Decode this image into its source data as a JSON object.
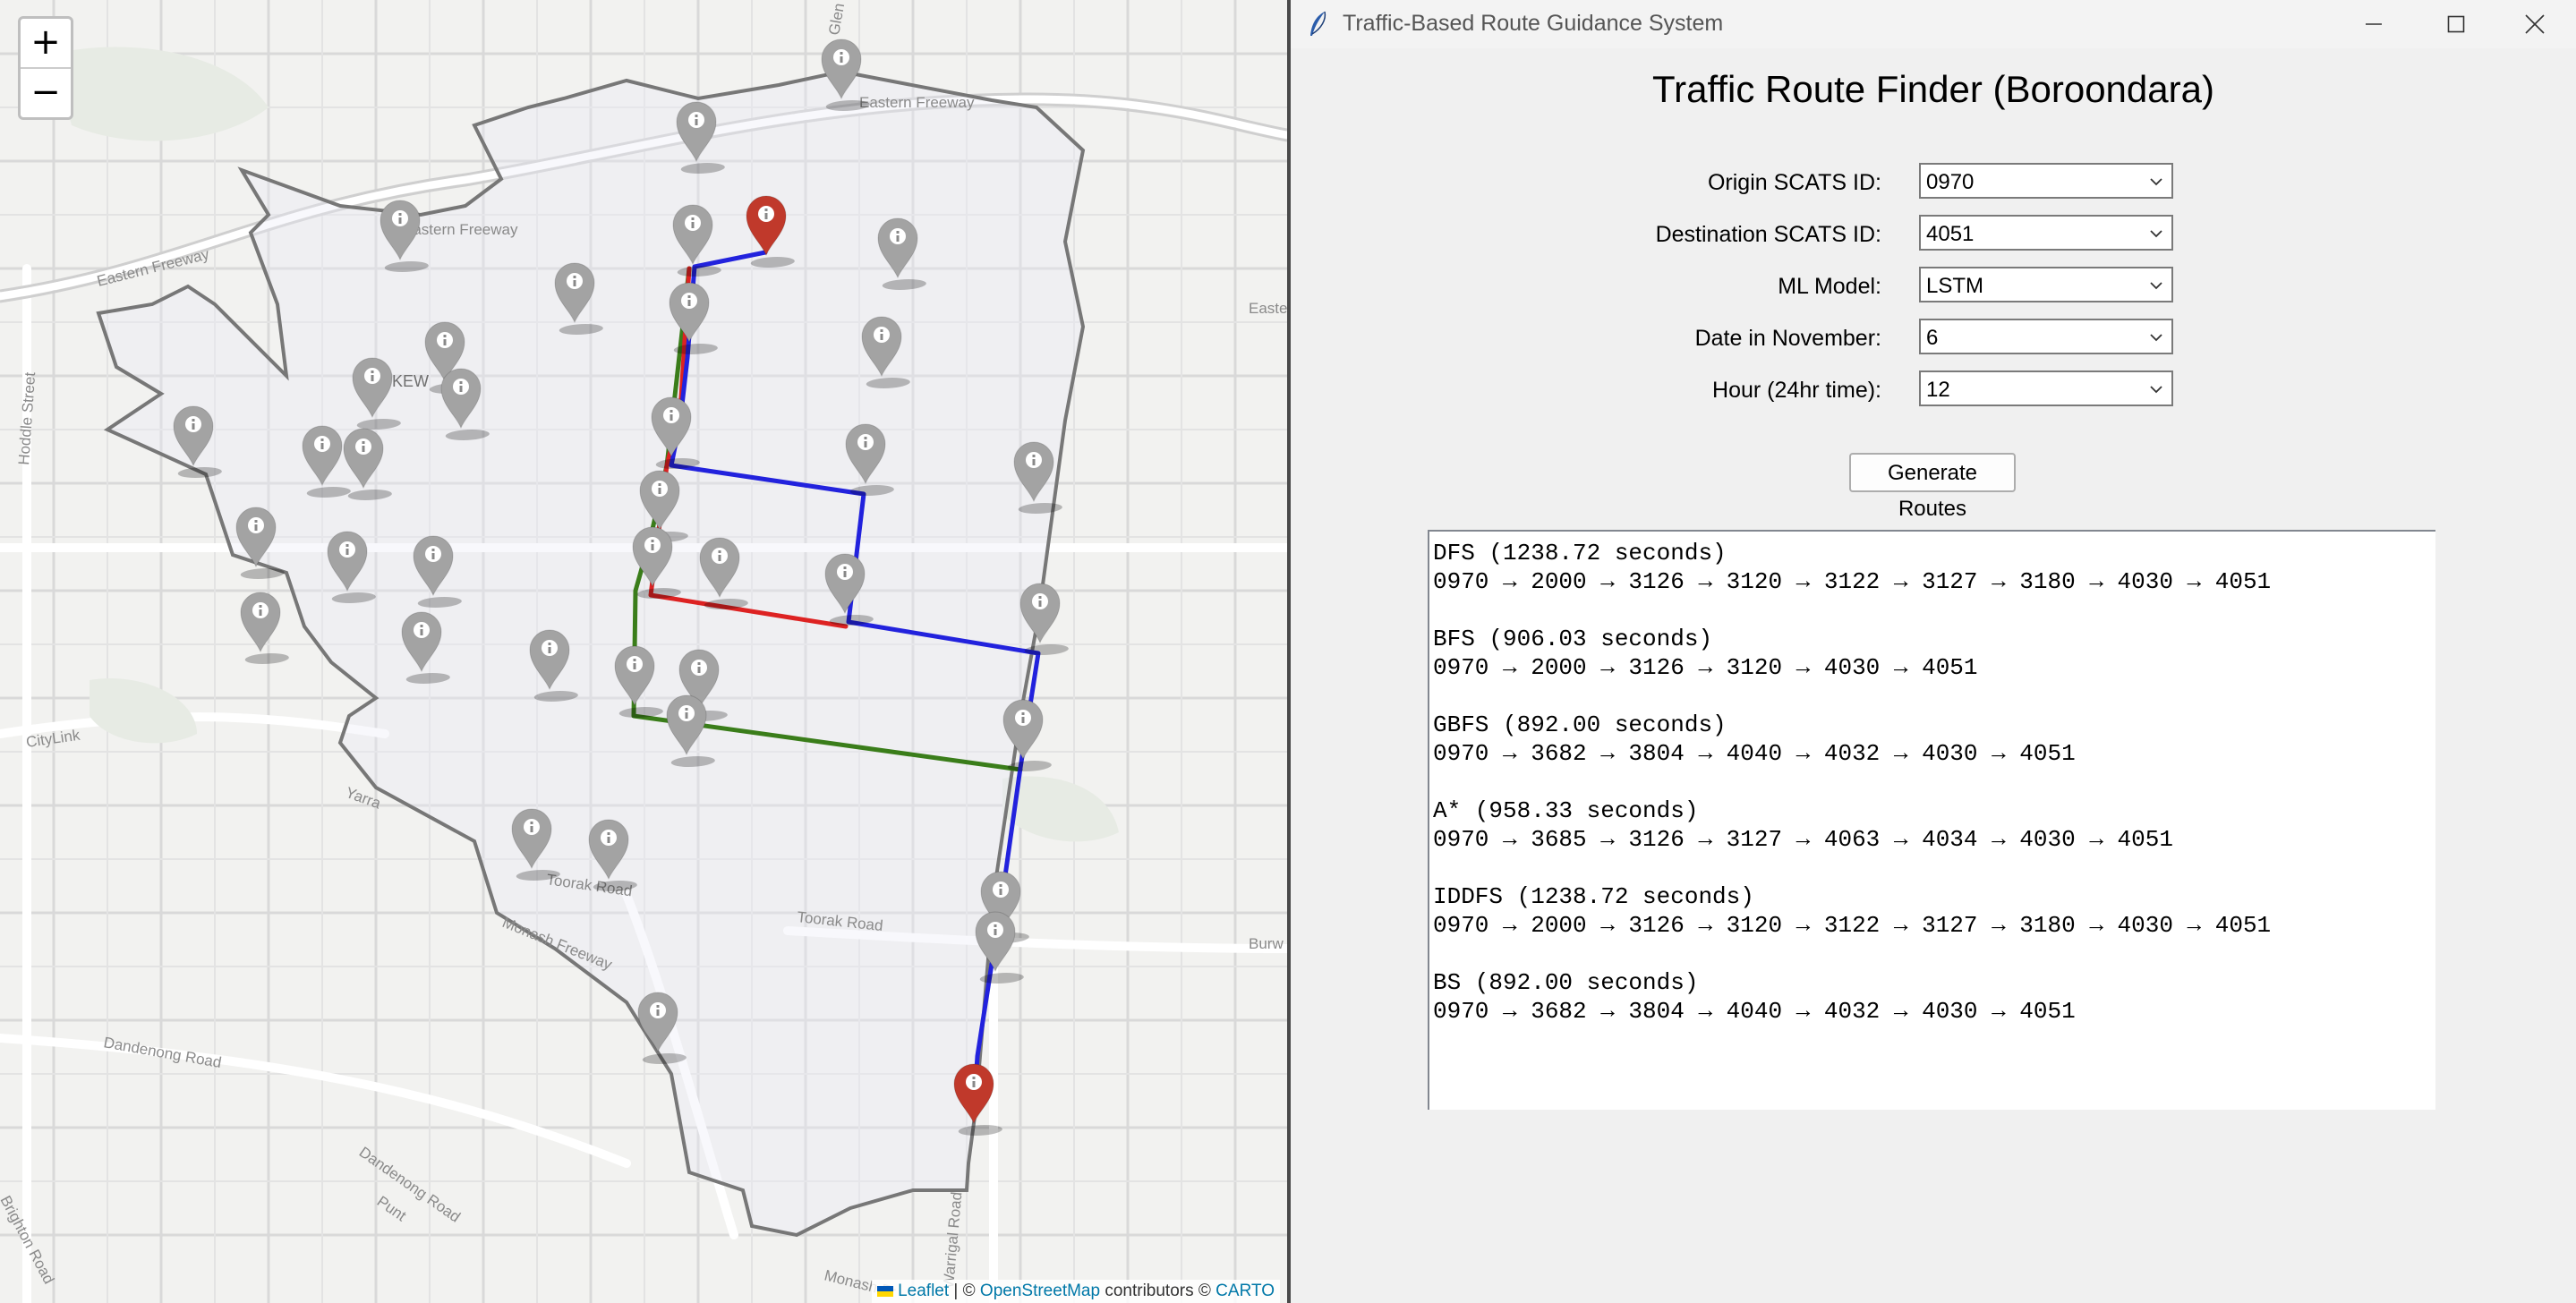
{
  "map": {
    "zoom_in": "+",
    "zoom_out": "−",
    "attribution": {
      "leaflet": "Leaflet",
      "sep": " | © ",
      "osm": "OpenStreetMap",
      "contributors": " contributors © ",
      "carto": "CARTO"
    },
    "labels": {
      "eastern_freeway_1": "Eastern Freeway",
      "eastern_freeway_2": "Eastern Freeway",
      "eastern_freeway_3": "Eastern Freeway",
      "kew": "KEW",
      "hoddle": "Hoddle Street",
      "citylink": "CityLink",
      "toorak_1": "Toorak Road",
      "toorak_2": "Toorak Road",
      "dandenong": "Dandenong Road",
      "monash_fwy": "Monash Freeway",
      "warrigal": "Warrigal Road",
      "burwood": "Burw",
      "easte": "Easte",
      "brighton": "Brighton Road",
      "dandenong_2": "Dandenong Road",
      "monash_fr": "Monash Fr",
      "yarra": "Yarra",
      "punt": "Punt",
      "glen": "Glen"
    },
    "colors": {
      "route_blue": "#2222dd",
      "route_red": "#dd2222",
      "route_green": "#3a7d1a",
      "boundary": "#777777",
      "marker_grey": "#a3a3a3",
      "marker_red": "#c0392b"
    }
  },
  "window": {
    "title": "Traffic-Based Route Guidance System",
    "heading": "Traffic Route Finder (Boroondara)",
    "form": [
      {
        "label": "Origin SCATS ID:",
        "value": "0970"
      },
      {
        "label": "Destination SCATS ID:",
        "value": "4051"
      },
      {
        "label": "ML Model:",
        "value": "LSTM"
      },
      {
        "label": "Date in November:",
        "value": "6"
      },
      {
        "label": "Hour (24hr time):",
        "value": "12"
      }
    ],
    "generate_label": "Generate Routes",
    "results": [
      {
        "head": "DFS (1238.72 seconds)",
        "path": "0970 → 2000 → 3126 → 3120 → 3122 → 3127 → 3180 → 4030 → 4051"
      },
      {
        "head": "BFS (906.03 seconds)",
        "path": "0970 → 2000 → 3126 → 3120 → 4030 → 4051"
      },
      {
        "head": "GBFS (892.00 seconds)",
        "path": "0970 → 3682 → 3804 → 4040 → 4032 → 4030 → 4051"
      },
      {
        "head": "A* (958.33 seconds)",
        "path": "0970 → 3685 → 3126 → 3127 → 4063 → 4034 → 4030 → 4051"
      },
      {
        "head": "IDDFS (1238.72 seconds)",
        "path": "0970 → 2000 → 3126 → 3120 → 3122 → 3127 → 3180 → 4030 → 4051"
      },
      {
        "head": "BS (892.00 seconds)",
        "path": "0970 → 3682 → 3804 → 4040 → 4032 → 4030 → 4051"
      }
    ]
  }
}
